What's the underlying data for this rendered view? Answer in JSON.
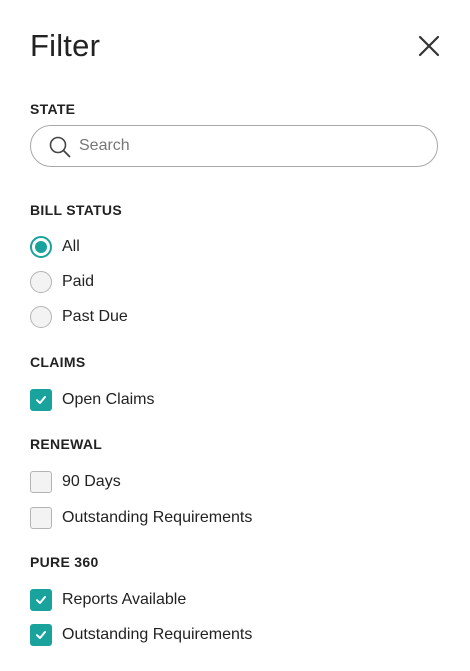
{
  "title": "Filter",
  "icons": {
    "close": "close-icon",
    "search": "search-icon",
    "check": "check-icon"
  },
  "colors": {
    "accent": "#19a39c"
  },
  "state": {
    "heading": "STATE",
    "search_placeholder": "Search",
    "search_value": ""
  },
  "bill_status": {
    "heading": "BILL STATUS",
    "options": [
      {
        "label": "All",
        "selected": true
      },
      {
        "label": "Paid",
        "selected": false
      },
      {
        "label": "Past Due",
        "selected": false
      }
    ]
  },
  "claims": {
    "heading": "CLAIMS",
    "options": [
      {
        "label": "Open Claims",
        "checked": true
      }
    ]
  },
  "renewal": {
    "heading": "RENEWAL",
    "options": [
      {
        "label": "90 Days",
        "checked": false
      },
      {
        "label": "Outstanding Requirements",
        "checked": false
      }
    ]
  },
  "pure360": {
    "heading": "PURE 360",
    "options": [
      {
        "label": "Reports Available",
        "checked": true
      },
      {
        "label": "Outstanding Requirements",
        "checked": true
      }
    ]
  }
}
